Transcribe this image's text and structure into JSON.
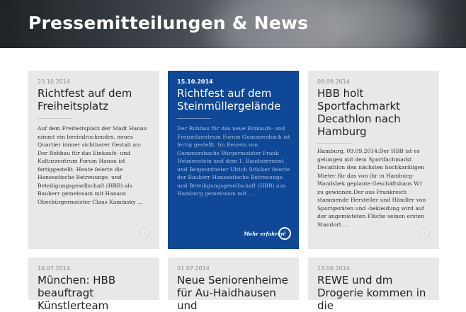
{
  "hero": {
    "title": "Pressemitteilungen & News"
  },
  "cards": [
    {
      "date": "23.10.2014",
      "title": "Richtfest auf dem Freiheitsplatz",
      "excerpt": "Auf dem Freiheitsplatz der Stadt Hanau nimmt ein beeindruckendes, neues Quartier immer sichtbarer Gestalt an: Der Rohbau für das Einkaufs- und Kulturzentrum Forum Hanau ist fertiggestellt. Heute feierte die Hanseatische Betreuungs- und Beteiligungsgesellschaft (HBB) als Bauherr gemeinsam mit Hanaus Oberbürgermeister Claus Kaminsky …"
    },
    {
      "date": "15.10.2014",
      "title": "Richtfest auf dem Steinmüllergelände",
      "excerpt": "Der Rohbau für das neue Einkaufs- und Freizeitzentrum Forum Gummersbach ist fertig gestellt. Im Beisein von Gummersbachs Bürgermeister Frank Helmenstein und dem 1. Baudezernent und Beigeordneter Ulrich Stücker feierte der Bauherr Hanseatische Betreuungs- und Beteiligungsgesellschaft (HBB) aus Hamburg gemeinsam mit …",
      "more_label": "Mehr erfahren"
    },
    {
      "date": "09.09.2014",
      "title": "HBB holt Sportfachmarkt Decathlon nach Hamburg",
      "excerpt": "Hamburg, 09.09.2014:Der HBB ist es gelungen mit dem Sportfachmarkt Decathlon den nächsten hochkarätigen Mieter für das von ihr in Hamburg-Wandsbek geplante Geschäftshaus W1 zu gewinnen.Der aus Frankreich stammende Hersteller und Händler von Sportgeräten und -bekleidung wird auf der angemieteten Fläche seinen ersten Standort …"
    },
    {
      "date": "10.07.2014",
      "title": "München: HBB beauftragt Künstlerteam"
    },
    {
      "date": "01.07.2014",
      "title": "Neue Seniorenheime für Au-Haidhausen und"
    },
    {
      "date": "13.06.2014",
      "title": "REWE und dm Drogerie kommen in die"
    }
  ],
  "icons": {
    "arrow": "arrow-right-circle-icon"
  }
}
